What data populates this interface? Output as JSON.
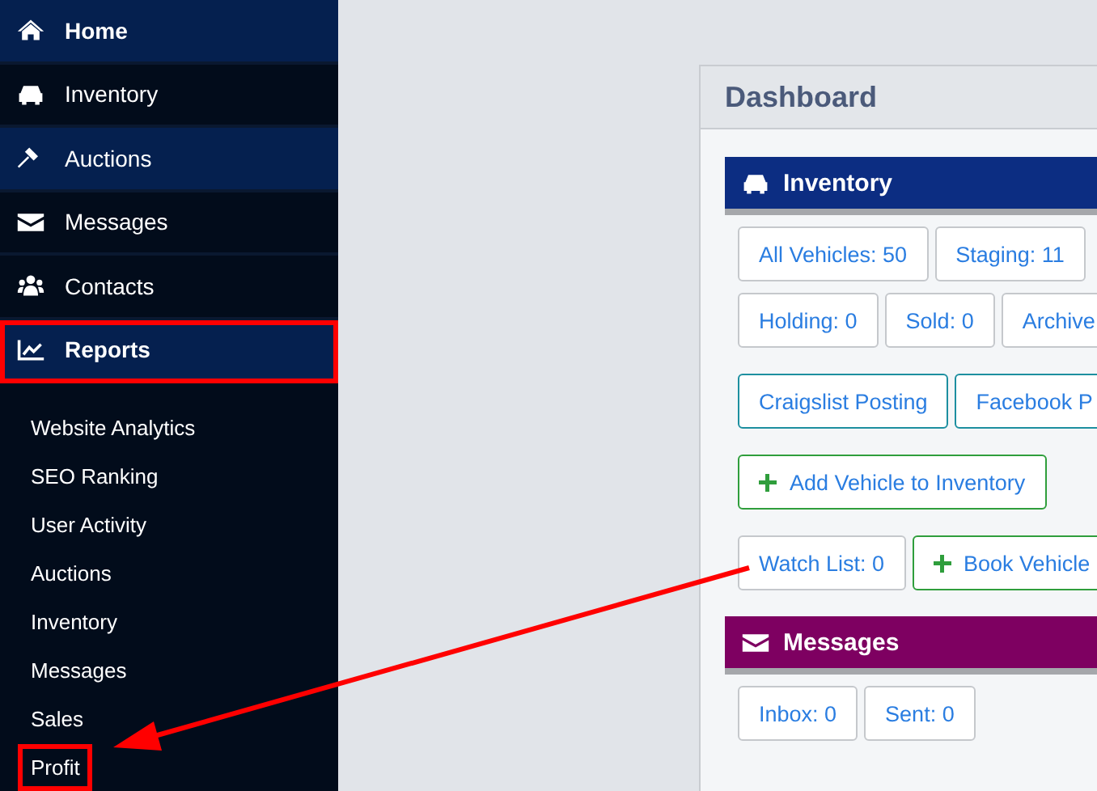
{
  "sidebar": {
    "items": [
      {
        "label": "Home",
        "kind": "home",
        "highlighted": true,
        "bold": true,
        "annotated": false
      },
      {
        "label": "Inventory",
        "kind": "car",
        "highlighted": false,
        "bold": false,
        "annotated": false
      },
      {
        "label": "Auctions",
        "kind": "gavel",
        "highlighted": true,
        "bold": false,
        "annotated": false
      },
      {
        "label": "Messages",
        "kind": "envelope",
        "highlighted": false,
        "bold": false,
        "annotated": false
      },
      {
        "label": "Contacts",
        "kind": "users",
        "highlighted": false,
        "bold": false,
        "annotated": false
      },
      {
        "label": "Reports",
        "kind": "chart",
        "highlighted": true,
        "bold": true,
        "annotated": true
      }
    ],
    "subitems": [
      {
        "label": "Website Analytics",
        "annotated": false
      },
      {
        "label": "SEO Ranking",
        "annotated": false
      },
      {
        "label": "User Activity",
        "annotated": false
      },
      {
        "label": "Auctions",
        "annotated": false
      },
      {
        "label": "Inventory",
        "annotated": false
      },
      {
        "label": "Messages",
        "annotated": false
      },
      {
        "label": "Sales",
        "annotated": false
      },
      {
        "label": "Profit",
        "annotated": true
      }
    ]
  },
  "dashboard": {
    "title": "Dashboard",
    "sections": [
      {
        "title": "Inventory",
        "kind": "car",
        "color": "#0c2d82",
        "rows": [
          [
            {
              "label": "All Vehicles: 50",
              "kind": "count"
            },
            {
              "label": "Staging: 11",
              "kind": "count"
            }
          ],
          [
            {
              "label": "Holding: 0",
              "kind": "count"
            },
            {
              "label": "Sold: 0",
              "kind": "count"
            },
            {
              "label": "Archive",
              "kind": "count"
            }
          ],
          [
            {
              "label": "Craigslist Posting",
              "kind": "post"
            },
            {
              "label": "Facebook P",
              "kind": "post"
            }
          ],
          [
            {
              "label": "Add Vehicle to Inventory",
              "kind": "add"
            }
          ],
          [
            {
              "label": "Watch List: 0",
              "kind": "count"
            },
            {
              "label": "Book Vehicle",
              "kind": "add"
            }
          ]
        ]
      },
      {
        "title": "Messages",
        "kind": "envelope",
        "color": "#7e0061",
        "rows": [
          [
            {
              "label": "Inbox: 0",
              "kind": "count"
            },
            {
              "label": "Sent: 0",
              "kind": "count"
            }
          ]
        ]
      }
    ]
  }
}
